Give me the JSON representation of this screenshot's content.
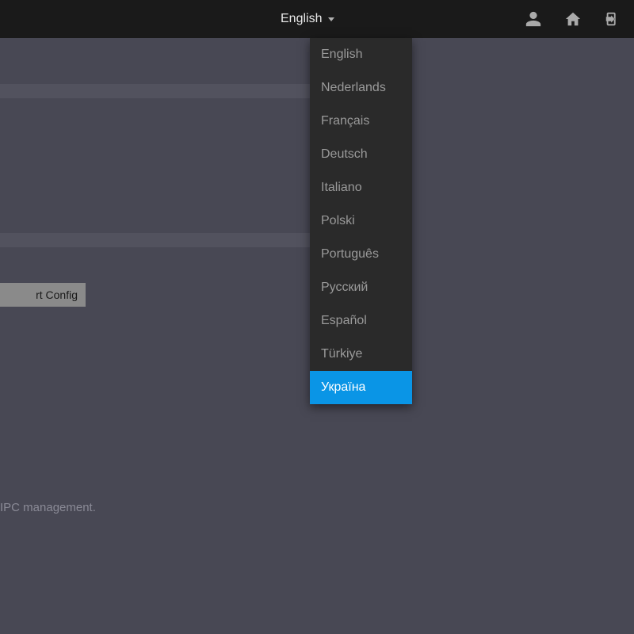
{
  "topbar": {
    "language_current": "English",
    "icons": {
      "user": "user-icon",
      "home": "home-icon",
      "logout": "logout-icon"
    }
  },
  "dropdown": {
    "items": [
      {
        "label": "English",
        "active": false
      },
      {
        "label": "Nederlands",
        "active": false
      },
      {
        "label": "Français",
        "active": false
      },
      {
        "label": "Deutsch",
        "active": false
      },
      {
        "label": "Italiano",
        "active": false
      },
      {
        "label": "Polski",
        "active": false
      },
      {
        "label": "Português",
        "active": false
      },
      {
        "label": "Русский",
        "active": false
      },
      {
        "label": "Español",
        "active": false
      },
      {
        "label": "Türkiye",
        "active": false
      },
      {
        "label": "Україна",
        "active": true
      }
    ]
  },
  "main": {
    "export_button": "rt Config"
  },
  "footer": {
    "text": "IPC management."
  },
  "colors": {
    "bg": "#484854",
    "topbar": "#1a1a1a",
    "dropdown_bg": "#2a2a2a",
    "accent": "#0a95e6"
  }
}
